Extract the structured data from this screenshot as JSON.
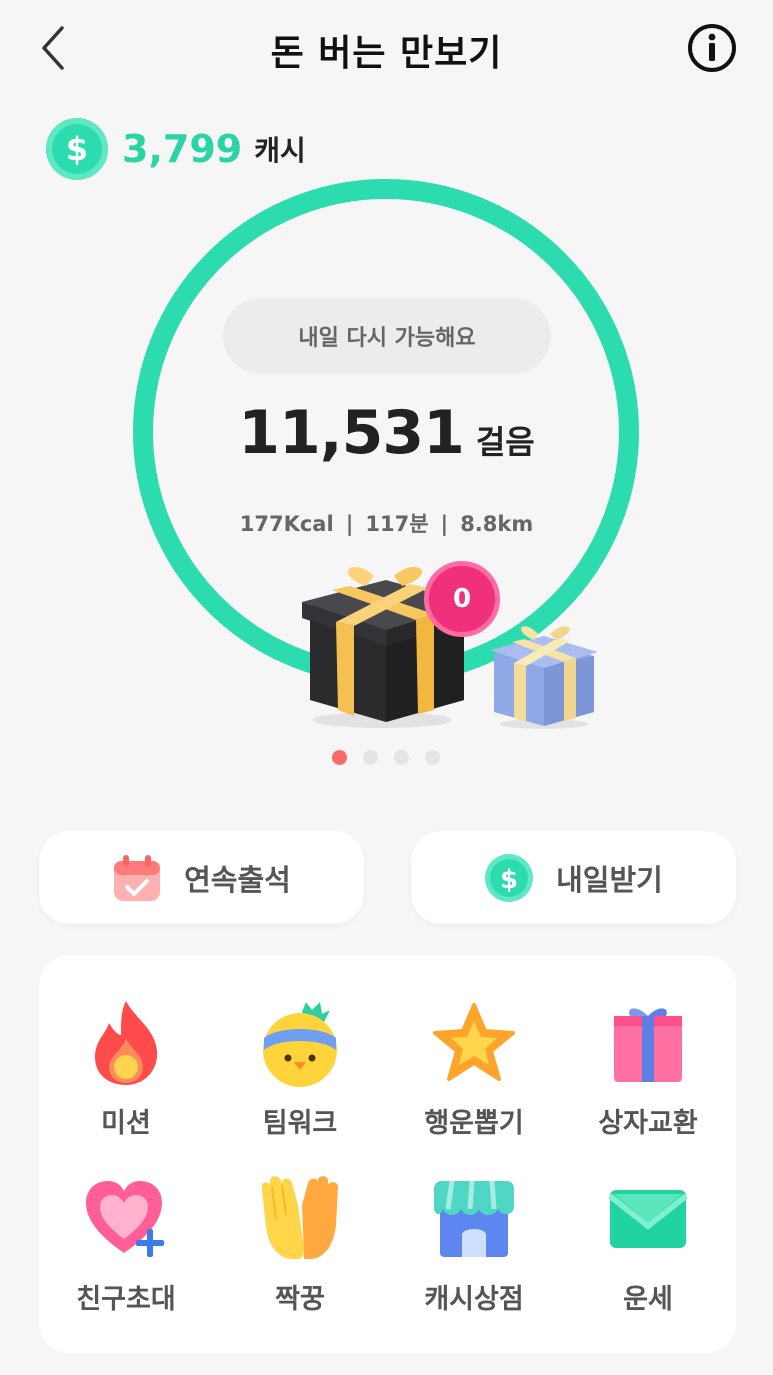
{
  "header": {
    "title": "돈 버는 만보기",
    "back_icon": "chevron-left-icon",
    "info_icon": "info-circle-icon"
  },
  "cash": {
    "icon": "dollar-coin-icon",
    "symbol": "$",
    "amount": "3,799",
    "unit": "캐시"
  },
  "tracker": {
    "status": "내일 다시 가능해요",
    "steps": "11,531",
    "steps_unit": "걸음",
    "kcal": "177Kcal",
    "minutes": "117분",
    "distance": "8.8km",
    "separator": "|",
    "gift_badge": "0",
    "ring_color": "#2ddcae"
  },
  "carousel": {
    "count": 4,
    "active_index": 0
  },
  "actions": {
    "attendance": {
      "label": "연속출석",
      "icon": "calendar-check-icon"
    },
    "tomorrow": {
      "label": "내일받기",
      "icon": "dollar-coin-icon",
      "symbol": "$"
    }
  },
  "menu": [
    {
      "label": "미션",
      "icon": "fire-icon"
    },
    {
      "label": "팀워크",
      "icon": "chick-headband-icon"
    },
    {
      "label": "행운뽑기",
      "icon": "star-icon"
    },
    {
      "label": "상자교환",
      "icon": "gift-box-icon"
    },
    {
      "label": "친구초대",
      "icon": "heart-plus-icon"
    },
    {
      "label": "짝꿍",
      "icon": "high-five-icon"
    },
    {
      "label": "캐시상점",
      "icon": "store-icon"
    },
    {
      "label": "운세",
      "icon": "envelope-icon"
    }
  ],
  "colors": {
    "accent": "#2ddcae",
    "badge": "#f0307b",
    "dot_active": "#fa6a6a"
  }
}
